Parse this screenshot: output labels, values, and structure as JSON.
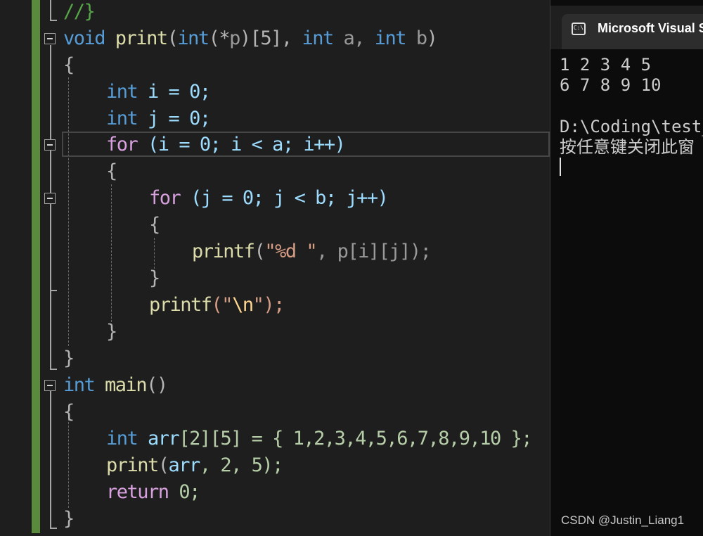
{
  "editor": {
    "code": {
      "l0_comment": "//}",
      "l1_void": "void",
      "l1_fn": "print",
      "l1_open": "(",
      "l1_int1": "int",
      "l1_ptr": "(*",
      "l1_p": "p",
      "l1_dim": ")[5],",
      "l1_int2": "int",
      "l1_a": "a,",
      "l1_int3": "int",
      "l1_b": "b",
      "l1_close": ")",
      "l2_brace": "{",
      "l3_int": "int",
      "l3_rest": "i = 0;",
      "l4_int": "int",
      "l4_rest": "j = 0;",
      "l5_for": "for",
      "l5_rest": "(i = 0; i < a; i++)",
      "l6_brace": "{",
      "l7_for": "for",
      "l7_rest": "(j = 0; j < b; j++)",
      "l8_brace": "{",
      "l9_fn": "printf",
      "l9_open": "(",
      "l9_str": "\"%d \"",
      "l9_rest": ", p[i][j]);",
      "l10_brace": "}",
      "l11_fn": "printf",
      "l11_open": "(\"",
      "l11_esc": "\\n",
      "l11_rest": "\");",
      "l12_brace": "}",
      "l13_brace": "}",
      "l14_int": "int",
      "l14_fn": "main",
      "l14_rest": "()",
      "l15_brace": "{",
      "l16_int": "int",
      "l16_var": "arr",
      "l16_rest": "[2][5] = { 1,2,3,4,5,6,7,8,9,10 };",
      "l17_fn": "print",
      "l17_open": "(",
      "l17_var": "arr",
      "l17_rest": ", 2, 5);",
      "l18_return": "return",
      "l18_rest": "0;",
      "l19_brace": "}"
    }
  },
  "console": {
    "title": "Microsoft Visual St",
    "icon": "C:\\",
    "lines": [
      "1 2 3 4 5",
      "6 7 8 9 10",
      "",
      "D:\\Coding\\test_",
      "按任意键关闭此窗"
    ]
  },
  "watermark": "CSDN @Justin_Liang1",
  "icons": {
    "fold": "collapse-box-icon",
    "console": "console-app-icon"
  }
}
